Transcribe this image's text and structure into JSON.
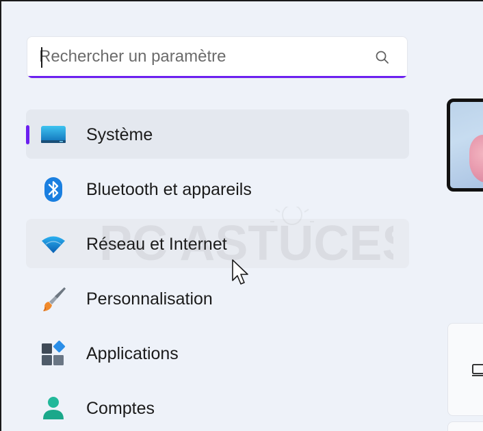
{
  "search": {
    "placeholder": "Rechercher un paramètre",
    "icon": "search-icon"
  },
  "nav": {
    "items": [
      {
        "label": "Système",
        "icon": "monitor-icon",
        "selected": true
      },
      {
        "label": "Bluetooth et appareils",
        "icon": "bluetooth-icon",
        "selected": false
      },
      {
        "label": "Réseau et Internet",
        "icon": "wifi-icon",
        "selected": false,
        "hover": true
      },
      {
        "label": "Personnalisation",
        "icon": "paintbrush-icon",
        "selected": false
      },
      {
        "label": "Applications",
        "icon": "apps-icon",
        "selected": false
      },
      {
        "label": "Comptes",
        "icon": "account-icon",
        "selected": false
      }
    ]
  },
  "watermark": {
    "text": "PC ASTUCES"
  },
  "colors": {
    "accent": "#6b1ff0",
    "background": "#eef2f9",
    "selected": "#e4e8ef"
  }
}
